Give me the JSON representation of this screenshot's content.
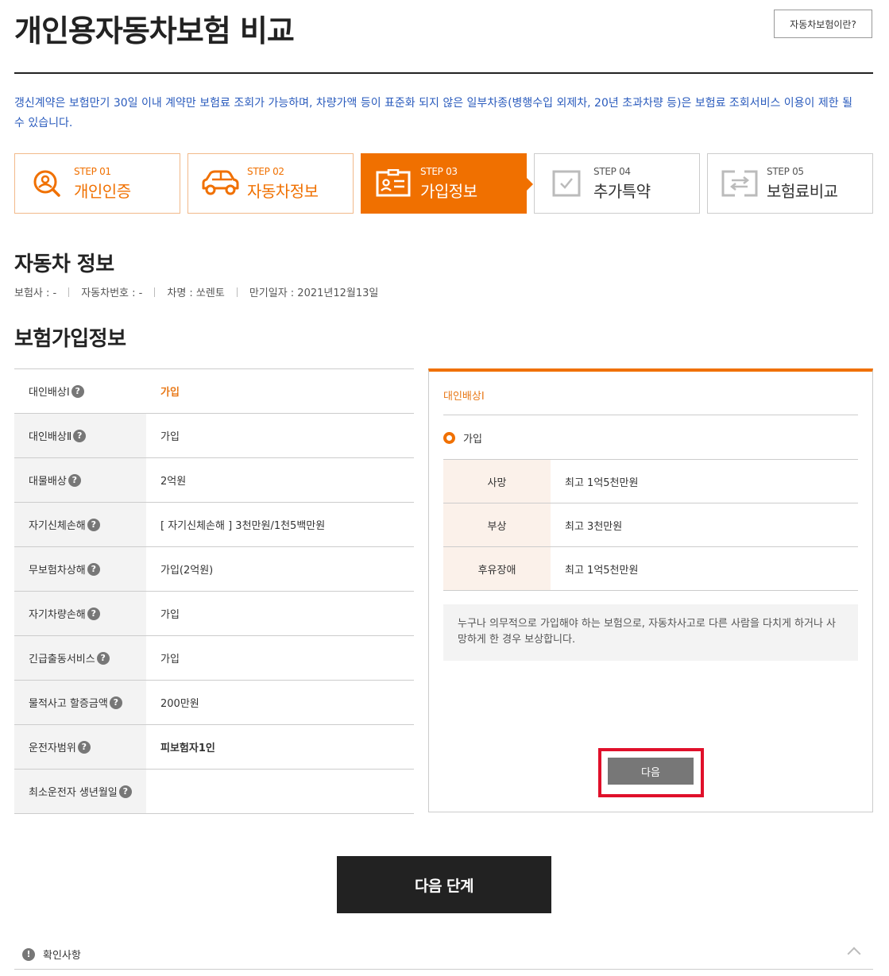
{
  "header": {
    "title": "개인용자동차보험 비교",
    "help_button": "자동차보험이란?"
  },
  "notice": "갱신계약은 보험만기 30일 이내 계약만 보험료 조회가 가능하며, 차량가액 등이 표준화 되지 않은 일부차종(병행수입 외제차, 20년 초과차량 등)은 보험료 조회서비스 이용이 제한 될 수 있습니다.",
  "steps": [
    {
      "num": "STEP 01",
      "label": "개인인증",
      "state": "done",
      "icon": "person-search-icon"
    },
    {
      "num": "STEP 02",
      "label": "자동차정보",
      "state": "done",
      "icon": "car-icon"
    },
    {
      "num": "STEP 03",
      "label": "가입정보",
      "state": "active",
      "icon": "id-card-icon"
    },
    {
      "num": "STEP 04",
      "label": "추가특약",
      "state": "pending",
      "icon": "checkbox-icon"
    },
    {
      "num": "STEP 05",
      "label": "보험료비교",
      "state": "pending",
      "icon": "compare-icon"
    }
  ],
  "car_section": {
    "title": "자동차 정보",
    "insurer": "보험사 : -",
    "plate": "자동차번호 : -",
    "model": "차명 : 쏘렌토",
    "expiry": "만기일자 : 2021년12월13일"
  },
  "insurance_section": {
    "title": "보험가입정보",
    "rows": [
      {
        "label": "대인배상Ⅰ",
        "value": "가입"
      },
      {
        "label": "대인배상Ⅱ",
        "value": "가입"
      },
      {
        "label": "대물배상",
        "value": "2억원"
      },
      {
        "label": "자기신체손해",
        "value": "[ 자기신체손해 ]  3천만원/1천5백만원"
      },
      {
        "label": "무보험차상해",
        "value": "가입(2억원)"
      },
      {
        "label": "자기차량손해",
        "value": "가입"
      },
      {
        "label": "긴급출동서비스",
        "value": "가입"
      },
      {
        "label": "물적사고 할증금액",
        "value": "200만원"
      },
      {
        "label": "운전자범위",
        "value": "피보험자1인"
      },
      {
        "label": "최소운전자 생년월일",
        "value": ""
      }
    ]
  },
  "detail_panel": {
    "title": "대인배상Ⅰ",
    "radio_label": "가입",
    "coverage": [
      {
        "label": "사망",
        "value": "최고 1억5천만원"
      },
      {
        "label": "부상",
        "value": "최고 3천만원"
      },
      {
        "label": "후유장애",
        "value": "최고 1억5천만원"
      }
    ],
    "description": "누구나 의무적으로 가입해야 하는 보험으로, 자동차사고로 다른 사람을 다치게 하거나 사망하게 한 경우 보상합니다.",
    "next_button": "다음"
  },
  "next_step_button": "다음 단계",
  "confirm_label": "확인사항",
  "colors": {
    "accent": "#f07000",
    "notice": "#2a5bbd",
    "highlight": "#e0102a"
  }
}
